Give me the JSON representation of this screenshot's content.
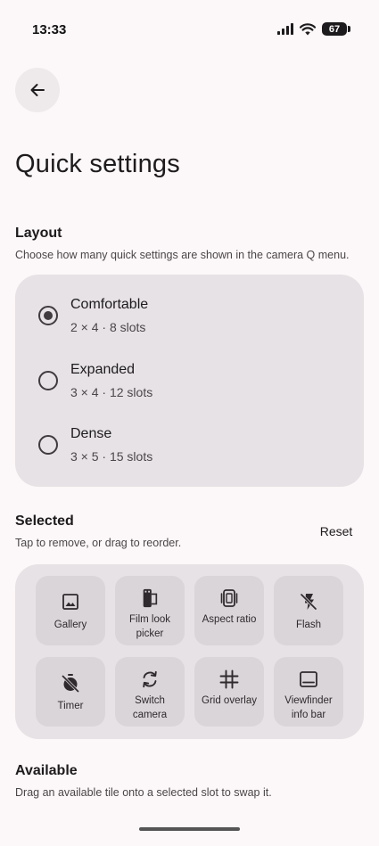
{
  "status": {
    "time": "13:33",
    "battery": "67"
  },
  "page": {
    "title": "Quick settings"
  },
  "layout": {
    "title": "Layout",
    "description": "Choose how many quick settings are shown in the camera Q menu.",
    "options": [
      {
        "label": "Comfortable",
        "sub": "2 × 4 · 8 slots",
        "selected": true
      },
      {
        "label": "Expanded",
        "sub": "3 × 4 · 12 slots",
        "selected": false
      },
      {
        "label": "Dense",
        "sub": "3 × 5 · 15 slots",
        "selected": false
      }
    ]
  },
  "selected": {
    "title": "Selected",
    "description": "Tap to remove, or drag to reorder.",
    "reset_label": "Reset",
    "tiles": [
      {
        "label": "Gallery",
        "icon": "gallery-icon"
      },
      {
        "label": "Film look picker",
        "icon": "film-look-icon"
      },
      {
        "label": "Aspect ratio",
        "icon": "aspect-ratio-icon"
      },
      {
        "label": "Flash",
        "icon": "flash-off-icon"
      },
      {
        "label": "Timer",
        "icon": "timer-off-icon"
      },
      {
        "label": "Switch camera",
        "icon": "switch-camera-icon"
      },
      {
        "label": "Grid overlay",
        "icon": "grid-icon"
      },
      {
        "label": "Viewfinder info bar",
        "icon": "info-bar-icon"
      }
    ]
  },
  "available": {
    "title": "Available",
    "description": "Drag an available tile onto a selected slot to swap it."
  }
}
